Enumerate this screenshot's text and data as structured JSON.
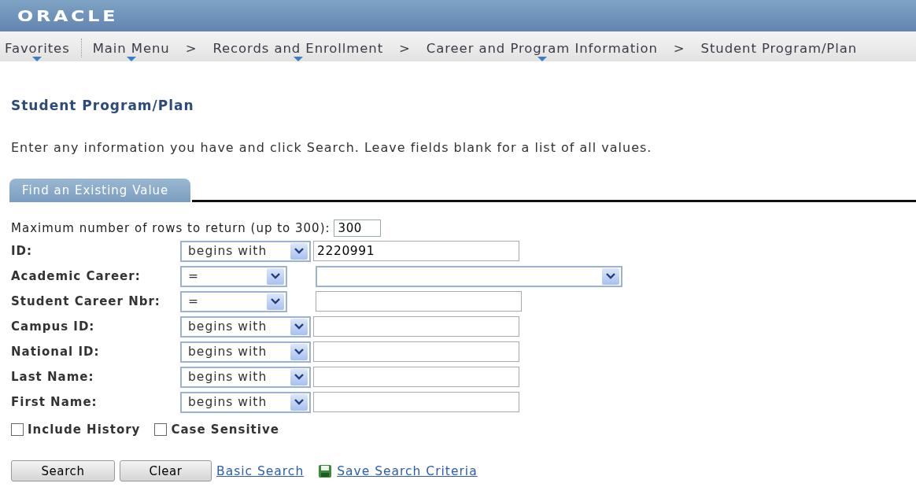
{
  "header": {
    "logo": "ORACLE"
  },
  "breadcrumbs": {
    "separator": ">",
    "items": [
      {
        "label": "Favorites",
        "kind": "favorites"
      },
      {
        "label": "Main Menu",
        "kind": "menu"
      },
      {
        "label": "Records and Enrollment",
        "kind": "menu"
      },
      {
        "label": "Career and Program Information",
        "kind": "menu"
      },
      {
        "label": "Student Program/Plan",
        "kind": "current"
      }
    ]
  },
  "page_title": "Student Program/Plan",
  "instructions": "Enter any information you have and click Search. Leave fields blank for a list of all values.",
  "tabs": [
    {
      "label": "Find an Existing Value",
      "selected": true
    }
  ],
  "max_rows": {
    "label": "Maximum number of rows to return (up to 300):",
    "value": "300"
  },
  "fields": [
    {
      "label": "ID:",
      "operator": {
        "label": "begins with",
        "kind": "long"
      },
      "kind": "text",
      "value": "2220991"
    },
    {
      "label": "Academic Career:",
      "operator": {
        "label": "=",
        "kind": "short"
      },
      "kind": "dropdown"
    },
    {
      "label": "Student Career Nbr:",
      "operator": {
        "label": "=",
        "kind": "short"
      },
      "kind": "text"
    },
    {
      "label": "Campus ID:",
      "operator": {
        "label": "begins with",
        "kind": "long"
      },
      "kind": "text"
    },
    {
      "label": "National ID:",
      "operator": {
        "label": "begins with",
        "kind": "long"
      },
      "kind": "text"
    },
    {
      "label": "Last Name:",
      "operator": {
        "label": "begins with",
        "kind": "long"
      },
      "kind": "text"
    },
    {
      "label": "First Name:",
      "operator": {
        "label": "begins with",
        "kind": "long"
      },
      "kind": "text"
    }
  ],
  "options": [
    {
      "label": "Include History",
      "checked": false
    },
    {
      "label": "Case Sensitive",
      "checked": false
    }
  ],
  "buttons": [
    "Search",
    "Clear"
  ],
  "links": [
    {
      "label": "Basic Search",
      "kind": "plain"
    },
    {
      "label": "Save Search Criteria",
      "kind": "save"
    }
  ]
}
